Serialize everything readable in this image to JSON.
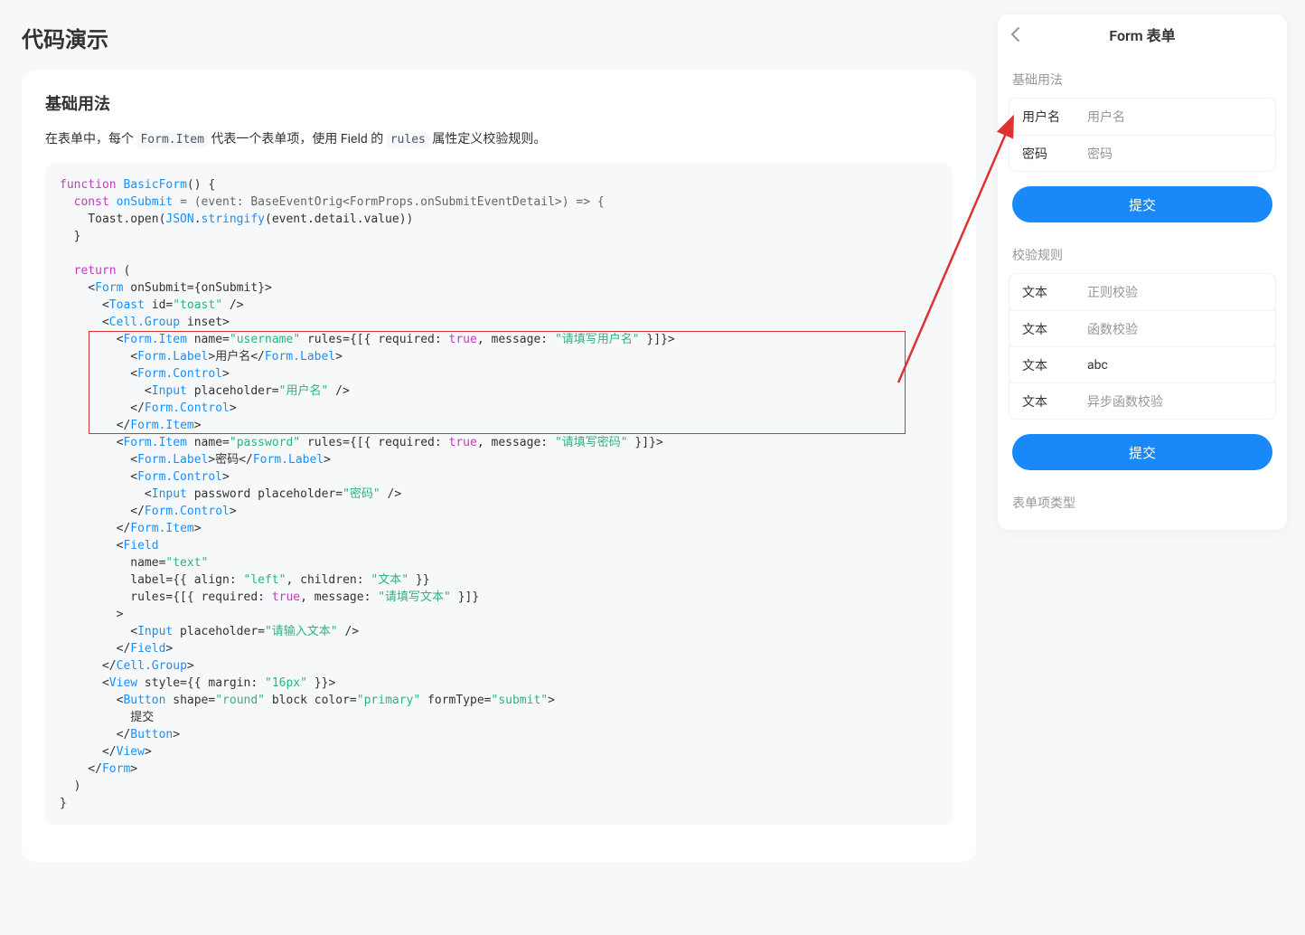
{
  "page": {
    "title": "代码演示"
  },
  "section": {
    "heading": "基础用法"
  },
  "desc": {
    "p1": "在表单中，每个 ",
    "m1": "Form.Item",
    "p2": " 代表一个表单项，使用 Field 的 ",
    "m2": "rules",
    "p3": " 属性定义校验规则。"
  },
  "code": {
    "l01a": "function",
    "l01b": " BasicForm",
    "l01c": "() {",
    "l02a": "  const",
    "l02b": " onSubmit ",
    "l02c": "= (event: BaseEventOrig<FormProps.onSubmitEventDetail>) => {",
    "l03a": "    Toast.open(",
    "l03b": "JSON",
    "l03c": ".",
    "l03d": "stringify",
    "l03e": "(event.detail.value))",
    "l04": "  }",
    "l05": "",
    "l06a": "  return",
    "l06b": " (",
    "l07a": "    <",
    "l07b": "Form",
    "l07c": " onSubmit={onSubmit}>",
    "l08a": "      <",
    "l08b": "Toast",
    "l08c": " id=",
    "l08d": "\"toast\"",
    "l08e": " />",
    "l09a": "      <",
    "l09b": "Cell.Group",
    "l09c": " inset>",
    "l10a": "        <",
    "l10b": "Form.Item",
    "l10c": " name=",
    "l10d": "\"username\"",
    "l10e": " rules={[{ required: ",
    "l10f": "true",
    "l10g": ", message: ",
    "l10h": "\"请填写用户名\"",
    "l10i": " }]}>",
    "l11a": "          <",
    "l11b": "Form.Label",
    "l11c": ">用户名</",
    "l11d": "Form.Label",
    "l11e": ">",
    "l12a": "          <",
    "l12b": "Form.Control",
    "l12c": ">",
    "l13a": "            <",
    "l13b": "Input",
    "l13c": " placeholder=",
    "l13d": "\"用户名\"",
    "l13e": " />",
    "l14a": "          </",
    "l14b": "Form.Control",
    "l14c": ">",
    "l15a": "        </",
    "l15b": "Form.Item",
    "l15c": ">",
    "l16a": "        <",
    "l16b": "Form.Item",
    "l16c": " name=",
    "l16d": "\"password\"",
    "l16e": " rules={[{ required: ",
    "l16f": "true",
    "l16g": ", message: ",
    "l16h": "\"请填写密码\"",
    "l16i": " }]}>",
    "l17a": "          <",
    "l17b": "Form.Label",
    "l17c": ">密码</",
    "l17d": "Form.Label",
    "l17e": ">",
    "l18a": "          <",
    "l18b": "Form.Control",
    "l18c": ">",
    "l19a": "            <",
    "l19b": "Input",
    "l19c": " password placeholder=",
    "l19d": "\"密码\"",
    "l19e": " />",
    "l20a": "          </",
    "l20b": "Form.Control",
    "l20c": ">",
    "l21a": "        </",
    "l21b": "Form.Item",
    "l21c": ">",
    "l22a": "        <",
    "l22b": "Field",
    "l23a": "          name=",
    "l23b": "\"text\"",
    "l24a": "          label={{ align: ",
    "l24b": "\"left\"",
    "l24c": ", children: ",
    "l24d": "\"文本\"",
    "l24e": " }}",
    "l25a": "          rules={[{ required: ",
    "l25b": "true",
    "l25c": ", message: ",
    "l25d": "\"请填写文本\"",
    "l25e": " }]}",
    "l26": "        >",
    "l27a": "          <",
    "l27b": "Input",
    "l27c": " placeholder=",
    "l27d": "\"请输入文本\"",
    "l27e": " />",
    "l28a": "        </",
    "l28b": "Field",
    "l28c": ">",
    "l29a": "      </",
    "l29b": "Cell.Group",
    "l29c": ">",
    "l30a": "      <",
    "l30b": "View",
    "l30c": " style={{ margin: ",
    "l30d": "\"16px\"",
    "l30e": " }}>",
    "l31a": "        <",
    "l31b": "Button",
    "l31c": " shape=",
    "l31d": "\"round\"",
    "l31e": " block color=",
    "l31f": "\"primary\"",
    "l31g": " formType=",
    "l31h": "\"submit\"",
    "l31i": ">",
    "l32": "          提交",
    "l33a": "        </",
    "l33b": "Button",
    "l33c": ">",
    "l34a": "      </",
    "l34b": "View",
    "l34c": ">",
    "l35a": "    </",
    "l35b": "Form",
    "l35c": ">",
    "l36": "  )",
    "l37": "}"
  },
  "phone": {
    "title": "Form 表单",
    "section1": "基础用法",
    "fields1": [
      {
        "label": "用户名",
        "placeholder": "用户名",
        "filled": false
      },
      {
        "label": "密码",
        "placeholder": "密码",
        "filled": false
      }
    ],
    "submit1": "提交",
    "section2": "校验规则",
    "fields2": [
      {
        "label": "文本",
        "placeholder": "正则校验",
        "filled": false
      },
      {
        "label": "文本",
        "placeholder": "函数校验",
        "filled": false
      },
      {
        "label": "文本",
        "placeholder": "abc",
        "filled": true
      },
      {
        "label": "文本",
        "placeholder": "异步函数校验",
        "filled": false
      }
    ],
    "submit2": "提交",
    "section3": "表单项类型"
  }
}
